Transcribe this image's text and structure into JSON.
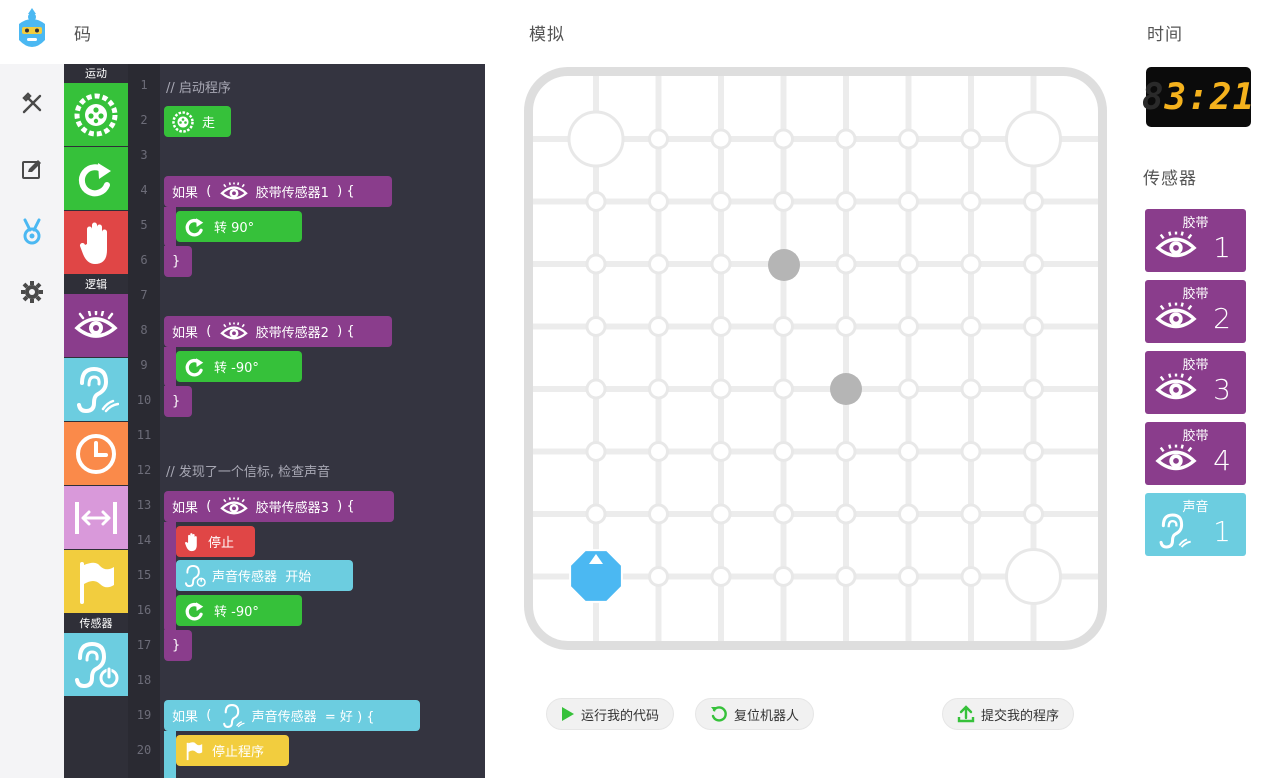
{
  "app": {
    "logo_icon": "robot-logo-icon"
  },
  "nav": [
    {
      "icon": "tools-icon"
    },
    {
      "icon": "edit-icon"
    },
    {
      "icon": "medal-icon"
    },
    {
      "icon": "gear-icon"
    }
  ],
  "headers": {
    "code": "码",
    "sim": "模拟",
    "time": "时间",
    "sensors": "传感器"
  },
  "palette": {
    "categories": {
      "motion": "运动",
      "logic": "逻辑",
      "sensor": "传感器"
    },
    "blocks": [
      "move-icon",
      "turn-icon",
      "stop-hand-icon",
      "eye-icon",
      "ear-sound-icon",
      "clock-icon",
      "distance-icon",
      "flag-icon",
      "ear-power-icon"
    ]
  },
  "code": {
    "line_numbers": [
      "1",
      "2",
      "3",
      "4",
      "5",
      "6",
      "7",
      "8",
      "9",
      "10",
      "11",
      "12",
      "13",
      "14",
      "15",
      "16",
      "17",
      "18",
      "19",
      "20"
    ],
    "comment1": "// 启动程序",
    "go": "走",
    "if": "如果",
    "paren_open": "(",
    "close": ") {",
    "tape1": "胶带传感器1",
    "turn90": "转 90°",
    "brace": "}",
    "tape2": "胶带传感器2",
    "turn_neg90": "转 -90°",
    "comment2": "// 发现了一个信标, 检查声音",
    "tape3": "胶带传感器3",
    "stop": "停止",
    "sound_sensor": "声音传感器",
    "start": "开始",
    "turn_neg90b": "转 -90°",
    "sound_sensor2": "声音传感器",
    "eq_good": "= 好 ) {",
    "stop_program": "停止程序"
  },
  "timer": {
    "ghost": "8",
    "display": "3:21"
  },
  "sensors": [
    {
      "label": "胶带",
      "num": "1",
      "color": "#8a3d8c",
      "icon": "eye-icon"
    },
    {
      "label": "胶带",
      "num": "2",
      "color": "#8a3d8c",
      "icon": "eye-icon"
    },
    {
      "label": "胶带",
      "num": "3",
      "color": "#8a3d8c",
      "icon": "eye-icon"
    },
    {
      "label": "胶带",
      "num": "4",
      "color": "#8a3d8c",
      "icon": "eye-icon"
    },
    {
      "label": "声音",
      "num": "1",
      "color": "#6ccde0",
      "icon": "ear-sound-icon"
    }
  ],
  "controls": {
    "run": "运行我的代码",
    "reset": "复位机器人",
    "submit": "提交我的程序"
  },
  "colors": {
    "motion_green": "#36c13a",
    "logic_purple": "#8a3d8c",
    "sound_cyan": "#6ccde0",
    "stop_red": "#e04646",
    "timer_digits": "#f5b21d",
    "robot_blue": "#4bb8f2"
  }
}
